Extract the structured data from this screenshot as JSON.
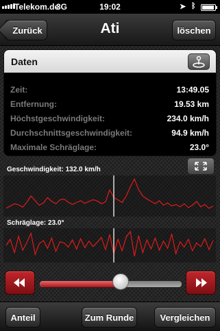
{
  "status_bar": {
    "carrier": "Telekom.de",
    "network": "3G",
    "time": "19:02",
    "battery_level": 0.95,
    "icons": [
      "signal-icon",
      "location-arrow-icon",
      "bluetooth-icon",
      "battery-icon"
    ]
  },
  "nav": {
    "back_label": "Zurück",
    "title": "Ati",
    "delete_label": "löschen"
  },
  "data_card": {
    "title": "Daten",
    "icon": "joystick-icon",
    "rows": [
      {
        "label": "Zeit:",
        "value": "13:49.05"
      },
      {
        "label": "Entfernung:",
        "value": "19.53 km"
      },
      {
        "label": "Höchstgeschwindigkeit:",
        "value": "234.0 km/h"
      },
      {
        "label": "Durchschnittsgeschwindigkeit:",
        "value": "94.9 km/h"
      },
      {
        "label": "Maximale Schräglage:",
        "value": "23.0°"
      }
    ]
  },
  "speed_chart": {
    "label": "Geschwindigkeit: 132.0 km/h",
    "expand_icon": "expand-arrows-icon",
    "cursor_fraction": 0.52
  },
  "lean_chart": {
    "label": "Schräglage: 23.0°",
    "cursor_fraction": 0.52
  },
  "playback": {
    "rewind_icon": "rewind-icon",
    "fast_forward_icon": "fast-forward-icon",
    "position_fraction": 0.57
  },
  "toolbar": {
    "share_label": "Anteil",
    "lap_label": "Zum Runde",
    "compare_label": "Vergleichen"
  },
  "colors": {
    "accent_red": "#c0262b",
    "line_red": "#e01b1b",
    "background": "#262626"
  },
  "chart_data": [
    {
      "type": "line",
      "title": "Geschwindigkeit: 132.0 km/h",
      "xlabel": "",
      "ylabel": "",
      "x": [
        0,
        1,
        2,
        3,
        4,
        5,
        6,
        7,
        8,
        9,
        10,
        11,
        12,
        13,
        14,
        15,
        16,
        17,
        18,
        19,
        20,
        21,
        22,
        23,
        24,
        25,
        26,
        27,
        28,
        29,
        30,
        31,
        32,
        33,
        34,
        35,
        36,
        37,
        38,
        39,
        40,
        41,
        42,
        43,
        44,
        45,
        46,
        47,
        48,
        49,
        50
      ],
      "series": [
        {
          "values": [
            40,
            55,
            70,
            62,
            48,
            80,
            120,
            90,
            60,
            75,
            110,
            85,
            70,
            95,
            100,
            80,
            65,
            78,
            90,
            72,
            85,
            96,
            88,
            70,
            82,
            160,
            110,
            95,
            78,
            120,
            180,
            230,
            160,
            120,
            100,
            85,
            70,
            90,
            60,
            75,
            55,
            65,
            50,
            70,
            45,
            60,
            85,
            50,
            65,
            40,
            55
          ]
        }
      ]
    },
    {
      "type": "line",
      "title": "Schräglage: 23.0°",
      "xlabel": "",
      "ylabel": "",
      "x": [
        0,
        1,
        2,
        3,
        4,
        5,
        6,
        7,
        8,
        9,
        10,
        11,
        12,
        13,
        14,
        15,
        16,
        17,
        18,
        19,
        20,
        21,
        22,
        23,
        24,
        25,
        26,
        27,
        28,
        29,
        30,
        31,
        32,
        33,
        34,
        35,
        36,
        37,
        38,
        39,
        40,
        41,
        42,
        43,
        44,
        45,
        46,
        47,
        48,
        49,
        50
      ],
      "series": [
        {
          "values": [
            0,
            10,
            -12,
            15,
            -8,
            5,
            20,
            -15,
            3,
            8,
            -5,
            12,
            -10,
            6,
            4,
            -3,
            9,
            -6,
            11,
            -4,
            7,
            -2,
            5,
            13,
            -7,
            18,
            -14,
            10,
            -9,
            14,
            23,
            -18,
            16,
            -12,
            9,
            -6,
            12,
            -8,
            7,
            -5,
            19,
            -14,
            6,
            -3,
            10,
            -9,
            4,
            -2,
            11,
            -7,
            8
          ]
        }
      ]
    }
  ]
}
